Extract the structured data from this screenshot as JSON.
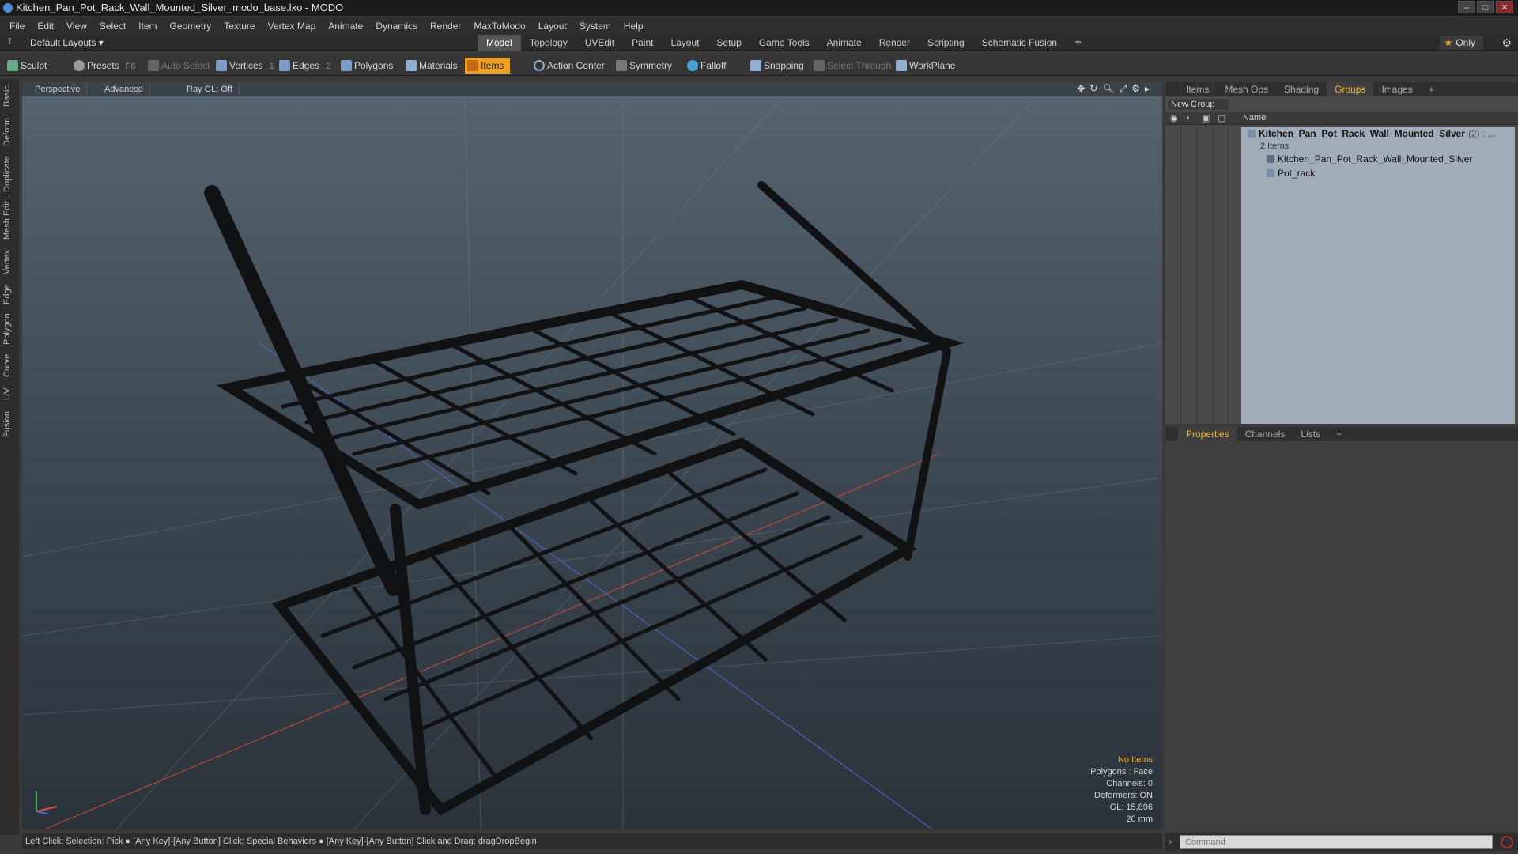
{
  "window": {
    "title": "Kitchen_Pan_Pot_Rack_Wall_Mounted_Silver_modo_base.lxo - MODO",
    "minimize": "–",
    "maximize": "□",
    "close": "✕"
  },
  "menu": [
    "File",
    "Edit",
    "View",
    "Select",
    "Item",
    "Geometry",
    "Texture",
    "Vertex Map",
    "Animate",
    "Dynamics",
    "Render",
    "MaxToModo",
    "Layout",
    "System",
    "Help"
  ],
  "layoutbar": {
    "layouts": "Default Layouts ▾",
    "tabs": [
      "Model",
      "Topology",
      "UVEdit",
      "Paint",
      "Layout",
      "Setup",
      "Game Tools",
      "Animate",
      "Render",
      "Scripting",
      "Schematic Fusion"
    ],
    "active_tab": "Model",
    "plus": "+",
    "only": "Only"
  },
  "toolbar": {
    "sculpt": "Sculpt",
    "presets": "Presets",
    "presets_key": "F6",
    "auto_select": "Auto Select",
    "vertices": "Vertices",
    "vertices_count": "1",
    "edges": "Edges",
    "edges_count": "2",
    "polygons": "Polygons",
    "materials": "Materials",
    "items": "Items",
    "action_center": "Action Center",
    "symmetry": "Symmetry",
    "falloff": "Falloff",
    "snapping": "Snapping",
    "select_through": "Select Through",
    "workplane": "WorkPlane"
  },
  "leftrail": [
    "Basic",
    "Deform",
    "Duplicate",
    "Mesh Edit",
    "Vertex",
    "Edge",
    "Polygon",
    "Curve",
    "UV",
    "Fusion"
  ],
  "viewport": {
    "view": "Perspective",
    "shading": "Advanced",
    "raygl": "Ray GL: Off",
    "hud": {
      "no_items": "No Items",
      "polygons": "Polygons : Face",
      "channels": "Channels: 0",
      "deformers": "Deformers: ON",
      "gl": "GL: 15,896",
      "scale": "20 mm"
    }
  },
  "status": "Left Click: Selection: Pick ●  [Any Key]-[Any Button] Click: Special Behaviors ●  [Any Key]-[Any Button] Click and Drag: dragDropBegin",
  "groups_panel": {
    "tabs": [
      "Items",
      "Mesh Ops",
      "Shading",
      "Groups",
      "Images"
    ],
    "active_tab": "Groups",
    "plus": "+",
    "new_group": "New Group",
    "col_name": "Name",
    "group_name": "Kitchen_Pan_Pot_Rack_Wall_Mounted_Silver",
    "group_count": "(2) : ...",
    "group_sub": "2 Items",
    "children": [
      "Kitchen_Pan_Pot_Rack_Wall_Mounted_Silver",
      "Pot_rack"
    ]
  },
  "properties_panel": {
    "tabs": [
      "Properties",
      "Channels",
      "Lists"
    ],
    "active_tab": "Properties",
    "plus": "+"
  },
  "command": {
    "placeholder": "Command"
  },
  "colors": {
    "accent": "#f0a020",
    "active_text": "#f0b429",
    "list_bg": "#a0acb7"
  }
}
